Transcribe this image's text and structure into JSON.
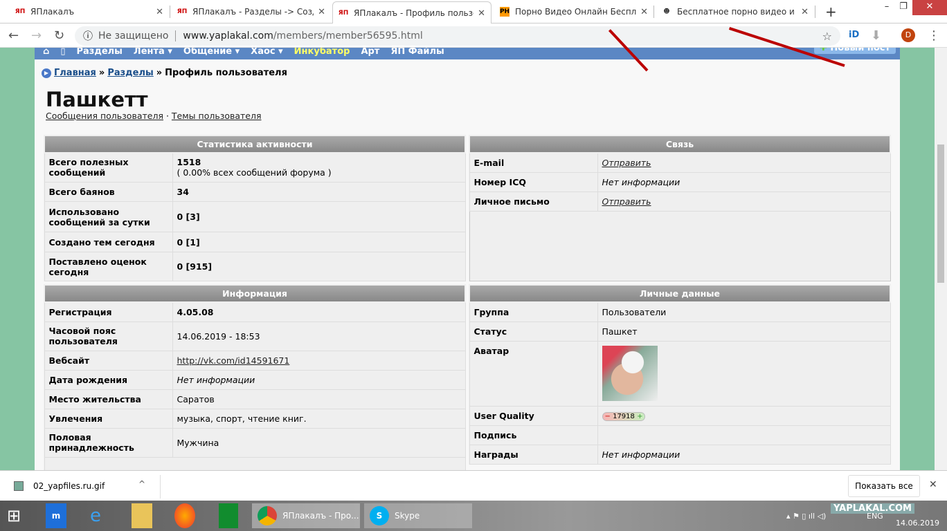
{
  "browser": {
    "tabs": [
      {
        "title": "ЯПлакалъ",
        "icon": "yap-favicon"
      },
      {
        "title": "ЯПлакалъ - Разделы -> Создан",
        "icon": "yap-favicon"
      },
      {
        "title": "ЯПлакалъ - Профиль пользова",
        "icon": "yap-favicon",
        "active": true
      },
      {
        "title": "Порно Видео Онлайн Бесплатн",
        "icon": "PH"
      },
      {
        "title": "Бесплатное порно видео и сек",
        "icon": "raccoon-favicon"
      }
    ],
    "security": "Не защищено",
    "url_host": "www.yaplakal.com",
    "url_path": "/members/member56595.html",
    "profile_initial": "D"
  },
  "site": {
    "menu": [
      "Разделы",
      "Лента ▾",
      "Общение ▾",
      "Хаос ▾",
      "Инкубатор",
      "Арт",
      "ЯП Файлы"
    ],
    "new_post": "Новый пост",
    "breadcrumb": {
      "home": "Главная",
      "sections": "Разделы",
      "current": "Профиль пользователя",
      "sep": "»"
    },
    "username": "Пашкетт",
    "links": {
      "messages": "Сообщения пользователя",
      "dot": "·",
      "topics": "Темы пользователя"
    }
  },
  "stats": {
    "title": "Статистика активности",
    "rows": [
      {
        "label": "Всего полезных сообщений",
        "value": "1518",
        "note": "( 0.00% всех сообщений форума )"
      },
      {
        "label": "Всего баянов",
        "value": "34"
      },
      {
        "label": "Использовано сообщений за сутки",
        "value": "0 [3]"
      },
      {
        "label": "Создано тем сегодня",
        "value": "0 [1]"
      },
      {
        "label": "Поставлено оценок сегодня",
        "value": "0 [915]"
      }
    ]
  },
  "contact": {
    "title": "Связь",
    "rows": [
      {
        "label": "E-mail",
        "value": "Отправить"
      },
      {
        "label": "Номер ICQ",
        "value": "Нет информации"
      },
      {
        "label": "Личное письмо",
        "value": "Отправить"
      }
    ]
  },
  "info": {
    "title": "Информация",
    "rows": [
      {
        "label": "Регистрация",
        "value": "4.05.08"
      },
      {
        "label": "Часовой пояс пользователя",
        "value": "14.06.2019 - 18:53"
      },
      {
        "label": "Вебсайт",
        "value": "http://vk.com/id14591671"
      },
      {
        "label": "Дата рождения",
        "value": "Нет информации"
      },
      {
        "label": "Место жительства",
        "value": "Саратов"
      },
      {
        "label": "Увлечения",
        "value": "музыка, спорт, чтение книг."
      },
      {
        "label": "Половая принадлежность",
        "value": "Мужчина"
      }
    ]
  },
  "personal": {
    "title": "Личные данные",
    "rows": [
      {
        "label": "Группа",
        "value": "Пользователи"
      },
      {
        "label": "Статус",
        "value": "Пашкет"
      },
      {
        "label": "Аватар"
      },
      {
        "label": "User Quality",
        "value": "17918",
        "minus": "−",
        "plus": "+"
      },
      {
        "label": "Подпись",
        "value": ""
      },
      {
        "label": "Награды",
        "value": "Нет информации"
      }
    ]
  },
  "download": {
    "file": "02_yapfiles.ru.gif",
    "show_all": "Показать все"
  },
  "taskbar": {
    "chrome": "ЯПлакалъ - Про...",
    "skype": "Skype",
    "lang": "ENG",
    "date": "14.06.2019",
    "watermark": "YAPLAKAL.COM"
  }
}
